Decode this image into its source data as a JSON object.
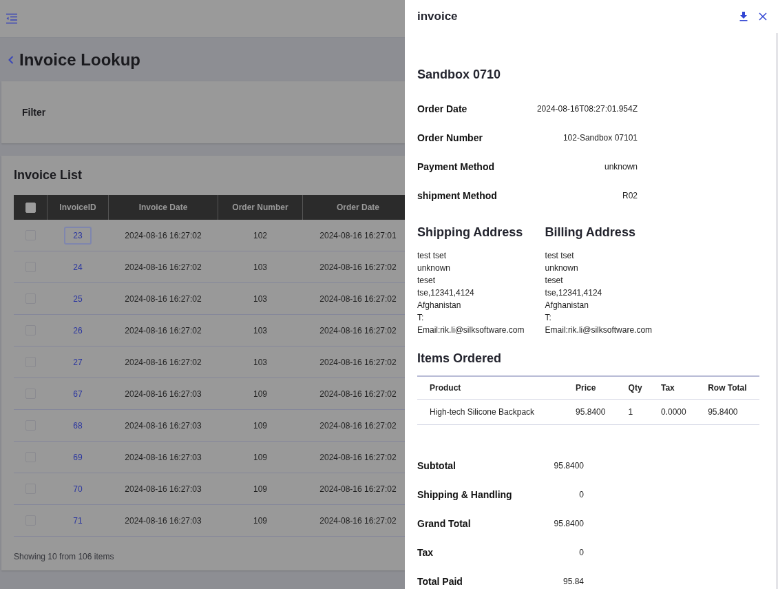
{
  "page": {
    "title": "Invoice Lookup"
  },
  "filter": {
    "title": "Filter"
  },
  "invoice_list": {
    "title": "Invoice List",
    "select_all_checked": false,
    "columns": [
      "InvoiceID",
      "Invoice Date",
      "Order Number",
      "Order Date"
    ],
    "rows": [
      {
        "id": "23",
        "invoice_date": "2024-08-16 16:27:02",
        "order_number": "102",
        "order_date": "2024-08-16 16:27:01",
        "checked": false,
        "focused": true
      },
      {
        "id": "24",
        "invoice_date": "2024-08-16 16:27:02",
        "order_number": "103",
        "order_date": "2024-08-16 16:27:02",
        "checked": false,
        "focused": false
      },
      {
        "id": "25",
        "invoice_date": "2024-08-16 16:27:02",
        "order_number": "103",
        "order_date": "2024-08-16 16:27:02",
        "checked": false,
        "focused": false
      },
      {
        "id": "26",
        "invoice_date": "2024-08-16 16:27:02",
        "order_number": "103",
        "order_date": "2024-08-16 16:27:02",
        "checked": false,
        "focused": false
      },
      {
        "id": "27",
        "invoice_date": "2024-08-16 16:27:02",
        "order_number": "103",
        "order_date": "2024-08-16 16:27:02",
        "checked": false,
        "focused": false
      },
      {
        "id": "67",
        "invoice_date": "2024-08-16 16:27:03",
        "order_number": "109",
        "order_date": "2024-08-16 16:27:02",
        "checked": false,
        "focused": false
      },
      {
        "id": "68",
        "invoice_date": "2024-08-16 16:27:03",
        "order_number": "109",
        "order_date": "2024-08-16 16:27:02",
        "checked": false,
        "focused": false
      },
      {
        "id": "69",
        "invoice_date": "2024-08-16 16:27:03",
        "order_number": "109",
        "order_date": "2024-08-16 16:27:02",
        "checked": false,
        "focused": false
      },
      {
        "id": "70",
        "invoice_date": "2024-08-16 16:27:03",
        "order_number": "109",
        "order_date": "2024-08-16 16:27:02",
        "checked": false,
        "focused": false
      },
      {
        "id": "71",
        "invoice_date": "2024-08-16 16:27:03",
        "order_number": "109",
        "order_date": "2024-08-16 16:27:02",
        "checked": false,
        "focused": false
      }
    ],
    "footer": "Showing 10 from 106 items"
  },
  "drawer": {
    "title": "invoice",
    "store": "Sandbox 0710",
    "details": [
      {
        "label": "Order Date",
        "value": "2024-08-16T08:27:01.954Z"
      },
      {
        "label": "Order Number",
        "value": "102-Sandbox 07101"
      },
      {
        "label": "Payment Method",
        "value": "unknown"
      },
      {
        "label": "shipment Method",
        "value": "R02"
      }
    ],
    "addresses": [
      {
        "title": "Shipping Address",
        "lines": [
          "test tset",
          "unknown",
          "teset",
          "tse,12341,4124",
          "Afghanistan",
          "T:",
          "Email:rik.li@silksoftware.com"
        ]
      },
      {
        "title": "Billing Address",
        "lines": [
          "test tset",
          "unknown",
          "teset",
          "tse,12341,4124",
          "Afghanistan",
          "T:",
          "Email:rik.li@silksoftware.com"
        ]
      }
    ],
    "items_title": "Items Ordered",
    "items_columns": [
      "Product",
      "Price",
      "Qty",
      "Tax",
      "Row Total"
    ],
    "items": [
      [
        "High-tech Silicone Backpack",
        "95.8400",
        "1",
        "0.0000",
        "95.8400"
      ]
    ],
    "totals": [
      {
        "label": "Subtotal",
        "value": "95.8400"
      },
      {
        "label": "Shipping & Handling",
        "value": "0"
      },
      {
        "label": "Grand Total",
        "value": "95.8400"
      },
      {
        "label": "Tax",
        "value": "0"
      },
      {
        "label": "Total Paid",
        "value": "95.84"
      }
    ]
  }
}
